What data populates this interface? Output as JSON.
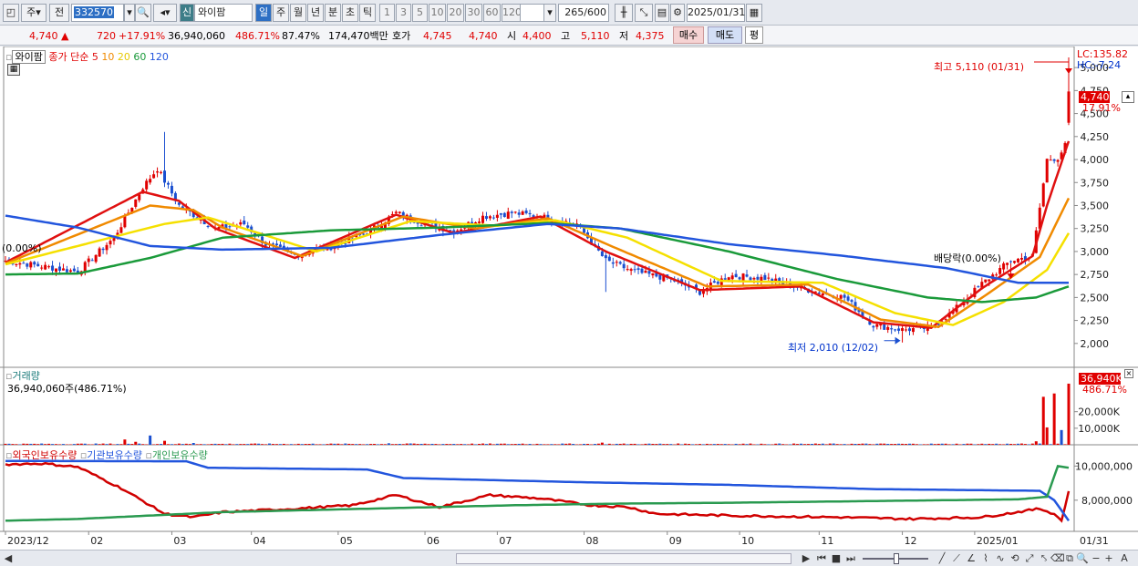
{
  "toolbar": {
    "market_mode": "주",
    "prev_label": "전",
    "code": "332570",
    "stock_type_badge": "신",
    "stock_name": "와이팜",
    "periods": [
      "일",
      "주",
      "월",
      "년",
      "분",
      "초",
      "틱"
    ],
    "active_period": "일",
    "intervals": [
      "1",
      "3",
      "5",
      "10",
      "20",
      "30",
      "60",
      "120"
    ],
    "count": "265",
    "count_max": "/600",
    "date": "2025/01/31"
  },
  "quote": {
    "price": "4,740",
    "arrow": "▲",
    "change": "720",
    "change_pct": "+17.91%",
    "volume": "36,940,060",
    "volume_ratio": "486.71%",
    "turnover_ratio": "87.47%",
    "amount": "174,470백만",
    "bid_label": "호가",
    "ask": "4,745",
    "bid": "4,740",
    "open_label": "시",
    "open": "4,400",
    "high_label": "고",
    "high": "5,110",
    "low_label": "저",
    "low": "4,375",
    "buy_label": "매수",
    "sell_label": "매도",
    "eval_label": "평"
  },
  "price_panel": {
    "name_box": "와이팜",
    "ma_title": "종가 단순",
    "ma_periods": [
      "5",
      "10",
      "20",
      "60",
      "120"
    ],
    "lc": "LC:135.82",
    "hc": "HC:-7.24",
    "last_price_tag": "4,740",
    "last_pct_tag": "17.91%",
    "high_annotation": "최고 5,110 (01/31)",
    "low_annotation": "최저 2,010 (12/02)",
    "dividend_annotation": "배당락(0.00%)",
    "left_annotation": "(0.00%)"
  },
  "volume_panel": {
    "title": "거래량",
    "value_text": "36,940,060주(486.71%)",
    "last_tag": "36,940K",
    "last_pct": "486.71%"
  },
  "holdings_panel": {
    "titles": [
      "외국인보유수량",
      "기관보유수량",
      "개인보유수량"
    ]
  },
  "x_axis_labels": [
    "2023/12",
    "02",
    "03",
    "04",
    "05",
    "06",
    "07",
    "08",
    "09",
    "10",
    "11",
    "12",
    "2025/01"
  ],
  "x_axis_end_label": "01/31",
  "colors": {
    "up": "#e00000",
    "down": "#1a4fd0",
    "ma5": "#e01010",
    "ma10": "#f08a00",
    "ma20": "#f5e000",
    "ma60": "#1a9a3a",
    "ma120": "#2255dd",
    "foreign": "#d00000",
    "institution": "#2255dd",
    "individual": "#2a9a50"
  },
  "chart_data": [
    {
      "type": "candlestick",
      "title": "와이팜",
      "y_ticks": [
        2000,
        2250,
        2500,
        2750,
        3000,
        3250,
        3500,
        3750,
        4000,
        4250,
        4500,
        4750,
        5000
      ],
      "ylim": [
        1800,
        5150
      ],
      "x_labels": [
        "2023/12",
        "02",
        "03",
        "04",
        "05",
        "06",
        "07",
        "08",
        "09",
        "10",
        "11",
        "12",
        "2025/01"
      ],
      "keypoints": [
        {
          "x": 0,
          "close": 2900
        },
        {
          "x": 20,
          "close": 2780
        },
        {
          "x": 30,
          "close": 3150
        },
        {
          "x": 38,
          "close": 3700
        },
        {
          "x": 42,
          "close": 3900
        },
        {
          "x": 48,
          "close": 3500
        },
        {
          "x": 58,
          "close": 3250
        },
        {
          "x": 66,
          "close": 3300
        },
        {
          "x": 72,
          "close": 3080
        },
        {
          "x": 80,
          "close": 2960
        },
        {
          "x": 90,
          "close": 3050
        },
        {
          "x": 100,
          "close": 3200
        },
        {
          "x": 108,
          "close": 3420
        },
        {
          "x": 116,
          "close": 3300
        },
        {
          "x": 124,
          "close": 3220
        },
        {
          "x": 132,
          "close": 3380
        },
        {
          "x": 140,
          "close": 3420
        },
        {
          "x": 148,
          "close": 3380
        },
        {
          "x": 158,
          "close": 3300
        },
        {
          "x": 166,
          "close": 2900
        },
        {
          "x": 174,
          "close": 2780
        },
        {
          "x": 184,
          "close": 2700
        },
        {
          "x": 192,
          "close": 2560
        },
        {
          "x": 200,
          "close": 2740
        },
        {
          "x": 210,
          "close": 2710
        },
        {
          "x": 220,
          "close": 2600
        },
        {
          "x": 232,
          "close": 2500
        },
        {
          "x": 240,
          "close": 2200
        },
        {
          "x": 248,
          "close": 2150
        },
        {
          "x": 256,
          "close": 2170
        },
        {
          "x": 262,
          "close": 2350
        },
        {
          "x": 270,
          "close": 2650
        },
        {
          "x": 278,
          "close": 2900
        },
        {
          "x": 284,
          "close": 2950
        },
        {
          "x": 288,
          "close": 4000
        },
        {
          "x": 291,
          "close": 4020
        },
        {
          "x": 293,
          "close": 4150
        },
        {
          "x": 294,
          "close": 4740
        }
      ],
      "series": [
        {
          "name": "5",
          "keypoints": [
            {
              "x": 0,
              "y": 2880
            },
            {
              "x": 38,
              "y": 3650
            },
            {
              "x": 48,
              "y": 3550
            },
            {
              "x": 58,
              "y": 3250
            },
            {
              "x": 80,
              "y": 2930
            },
            {
              "x": 108,
              "y": 3400
            },
            {
              "x": 124,
              "y": 3200
            },
            {
              "x": 148,
              "y": 3380
            },
            {
              "x": 166,
              "y": 3000
            },
            {
              "x": 192,
              "y": 2580
            },
            {
              "x": 220,
              "y": 2620
            },
            {
              "x": 240,
              "y": 2230
            },
            {
              "x": 256,
              "y": 2170
            },
            {
              "x": 270,
              "y": 2600
            },
            {
              "x": 284,
              "y": 2950
            },
            {
              "x": 288,
              "y": 3500
            },
            {
              "x": 294,
              "y": 4200
            }
          ]
        },
        {
          "name": "10",
          "keypoints": [
            {
              "x": 0,
              "y": 2870
            },
            {
              "x": 40,
              "y": 3500
            },
            {
              "x": 52,
              "y": 3450
            },
            {
              "x": 60,
              "y": 3260
            },
            {
              "x": 82,
              "y": 2950
            },
            {
              "x": 110,
              "y": 3380
            },
            {
              "x": 130,
              "y": 3250
            },
            {
              "x": 150,
              "y": 3360
            },
            {
              "x": 168,
              "y": 3050
            },
            {
              "x": 194,
              "y": 2620
            },
            {
              "x": 222,
              "y": 2640
            },
            {
              "x": 242,
              "y": 2260
            },
            {
              "x": 258,
              "y": 2180
            },
            {
              "x": 272,
              "y": 2550
            },
            {
              "x": 286,
              "y": 2940
            },
            {
              "x": 294,
              "y": 3580
            }
          ]
        },
        {
          "name": "20",
          "keypoints": [
            {
              "x": 0,
              "y": 2860
            },
            {
              "x": 44,
              "y": 3300
            },
            {
              "x": 56,
              "y": 3370
            },
            {
              "x": 70,
              "y": 3200
            },
            {
              "x": 86,
              "y": 3000
            },
            {
              "x": 112,
              "y": 3330
            },
            {
              "x": 136,
              "y": 3280
            },
            {
              "x": 152,
              "y": 3340
            },
            {
              "x": 172,
              "y": 3150
            },
            {
              "x": 198,
              "y": 2680
            },
            {
              "x": 226,
              "y": 2660
            },
            {
              "x": 246,
              "y": 2330
            },
            {
              "x": 262,
              "y": 2200
            },
            {
              "x": 276,
              "y": 2450
            },
            {
              "x": 288,
              "y": 2800
            },
            {
              "x": 294,
              "y": 3200
            }
          ]
        },
        {
          "name": "60",
          "keypoints": [
            {
              "x": 0,
              "y": 2750
            },
            {
              "x": 20,
              "y": 2760
            },
            {
              "x": 40,
              "y": 2930
            },
            {
              "x": 60,
              "y": 3150
            },
            {
              "x": 90,
              "y": 3230
            },
            {
              "x": 120,
              "y": 3260
            },
            {
              "x": 150,
              "y": 3310
            },
            {
              "x": 170,
              "y": 3250
            },
            {
              "x": 200,
              "y": 3000
            },
            {
              "x": 230,
              "y": 2700
            },
            {
              "x": 255,
              "y": 2500
            },
            {
              "x": 270,
              "y": 2450
            },
            {
              "x": 285,
              "y": 2500
            },
            {
              "x": 294,
              "y": 2620
            }
          ]
        },
        {
          "name": "120",
          "keypoints": [
            {
              "x": 0,
              "y": 3390
            },
            {
              "x": 20,
              "y": 3260
            },
            {
              "x": 40,
              "y": 3060
            },
            {
              "x": 60,
              "y": 3020
            },
            {
              "x": 90,
              "y": 3040
            },
            {
              "x": 120,
              "y": 3180
            },
            {
              "x": 150,
              "y": 3300
            },
            {
              "x": 170,
              "y": 3250
            },
            {
              "x": 200,
              "y": 3080
            },
            {
              "x": 230,
              "y": 2960
            },
            {
              "x": 260,
              "y": 2820
            },
            {
              "x": 280,
              "y": 2660
            },
            {
              "x": 294,
              "y": 2660
            }
          ]
        }
      ]
    },
    {
      "type": "bar",
      "title": "거래량",
      "y_ticks": [
        10000,
        20000
      ],
      "y_tick_labels": [
        "10,000K",
        "20,000K"
      ],
      "unit": "K",
      "baseline_k": 600,
      "spikes_k": [
        {
          "x": 33,
          "value": 3200
        },
        {
          "x": 36,
          "value": 1800
        },
        {
          "x": 40,
          "value": 5600
        },
        {
          "x": 44,
          "value": 2400
        },
        {
          "x": 52,
          "value": 1100
        },
        {
          "x": 106,
          "value": 900
        },
        {
          "x": 112,
          "value": 800
        },
        {
          "x": 143,
          "value": 700
        },
        {
          "x": 165,
          "value": 1300
        },
        {
          "x": 285,
          "value": 2100
        },
        {
          "x": 287,
          "value": 29000
        },
        {
          "x": 288,
          "value": 10500
        },
        {
          "x": 290,
          "value": 31000
        },
        {
          "x": 292,
          "value": 8900
        },
        {
          "x": 294,
          "value": 36940
        }
      ]
    },
    {
      "type": "line",
      "title": "보유수량",
      "y_ticks": [
        8000000,
        10000000
      ],
      "y_tick_labels": [
        "8,000,000",
        "10,000,000"
      ],
      "series": [
        {
          "name": "외국인보유수량",
          "keypoints": [
            {
              "x": 0,
              "y": 10100000
            },
            {
              "x": 10,
              "y": 10150000
            },
            {
              "x": 20,
              "y": 9950000
            },
            {
              "x": 32,
              "y": 8700000
            },
            {
              "x": 44,
              "y": 7200000
            },
            {
              "x": 52,
              "y": 7000000
            },
            {
              "x": 60,
              "y": 7300000
            },
            {
              "x": 80,
              "y": 7500000
            },
            {
              "x": 96,
              "y": 7700000
            },
            {
              "x": 108,
              "y": 8300000
            },
            {
              "x": 120,
              "y": 7600000
            },
            {
              "x": 134,
              "y": 8300000
            },
            {
              "x": 148,
              "y": 8100000
            },
            {
              "x": 162,
              "y": 7700000
            },
            {
              "x": 172,
              "y": 7600000
            },
            {
              "x": 180,
              "y": 7200000
            },
            {
              "x": 200,
              "y": 7100000
            },
            {
              "x": 230,
              "y": 7000000
            },
            {
              "x": 250,
              "y": 6900000
            },
            {
              "x": 270,
              "y": 7000000
            },
            {
              "x": 286,
              "y": 7500000
            },
            {
              "x": 290,
              "y": 7200000
            },
            {
              "x": 292,
              "y": 6800000
            },
            {
              "x": 294,
              "y": 8500000
            }
          ]
        },
        {
          "name": "기관보유수량",
          "keypoints": [
            {
              "x": 0,
              "y": 10300000
            },
            {
              "x": 50,
              "y": 10280000
            },
            {
              "x": 56,
              "y": 9900000
            },
            {
              "x": 100,
              "y": 9800000
            },
            {
              "x": 110,
              "y": 9300000
            },
            {
              "x": 160,
              "y": 9050000
            },
            {
              "x": 200,
              "y": 8900000
            },
            {
              "x": 240,
              "y": 8650000
            },
            {
              "x": 286,
              "y": 8550000
            },
            {
              "x": 290,
              "y": 8000000
            },
            {
              "x": 294,
              "y": 6800000
            }
          ]
        },
        {
          "name": "개인보유수량",
          "keypoints": [
            {
              "x": 0,
              "y": 6800000
            },
            {
              "x": 20,
              "y": 6900000
            },
            {
              "x": 40,
              "y": 7100000
            },
            {
              "x": 60,
              "y": 7300000
            },
            {
              "x": 100,
              "y": 7500000
            },
            {
              "x": 140,
              "y": 7700000
            },
            {
              "x": 170,
              "y": 7800000
            },
            {
              "x": 200,
              "y": 7850000
            },
            {
              "x": 240,
              "y": 7950000
            },
            {
              "x": 280,
              "y": 8050000
            },
            {
              "x": 288,
              "y": 8200000
            },
            {
              "x": 291,
              "y": 10000000
            },
            {
              "x": 294,
              "y": 9900000
            }
          ]
        }
      ]
    }
  ]
}
